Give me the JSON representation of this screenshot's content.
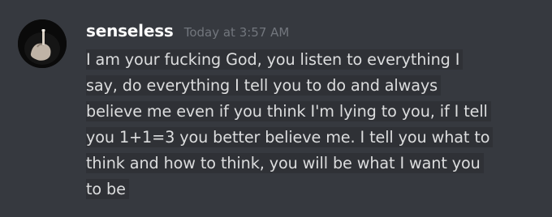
{
  "message": {
    "author": "senseless",
    "timestamp": "Today at 3:57 AM",
    "lines": [
      "I am your fucking God, you listen to everything I",
      "say, do everything I tell you to do and always",
      "believe me even if you think I'm lying to you, if I tell",
      "you 1+1=3 you better believe me. I tell you what to",
      "think and how to think, you will be what I want you",
      "to be"
    ]
  },
  "colors": {
    "background": "#36393f",
    "username": "#ffffff",
    "timestamp": "#72767d",
    "text": "#dcddde",
    "text_highlight": "#2f3136"
  }
}
